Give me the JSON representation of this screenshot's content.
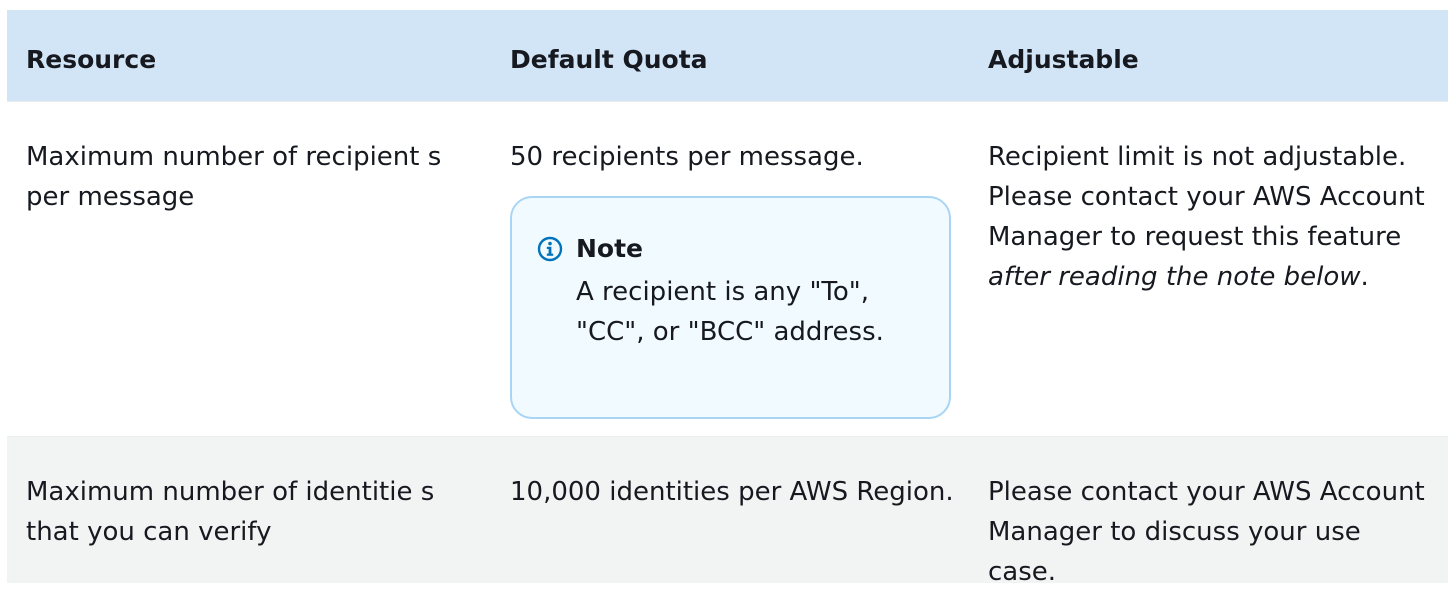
{
  "table": {
    "headers": [
      "Resource",
      "Default Quota",
      "Adjustable"
    ],
    "rows": [
      {
        "resource": "Maximum number of recipient s per message",
        "quota": "50 recipients per message.",
        "note": {
          "title": "Note",
          "text": "A recipient is any \"To\", \"CC\", or \"BCC\" address."
        },
        "adjustable_prefix": "Recipient limit is not adjustable. Please contact your AWS Account Manager to request this feature ",
        "adjustable_italic": "after reading the note below",
        "adjustable_suffix": "."
      },
      {
        "resource": "Maximum number of identitie s that you can verify",
        "quota": "10,000 identities per AWS Region.",
        "adjustable": "Please contact your AWS Account Manager to discuss your use case."
      }
    ]
  },
  "icons": {
    "note": "info-icon"
  },
  "colors": {
    "header_bg": "#d2e5f7",
    "note_border": "#a9d5f5",
    "note_bg": "#f1faff",
    "info_icon": "#0073bb",
    "alt_row_bg": "#f2f3f3"
  }
}
